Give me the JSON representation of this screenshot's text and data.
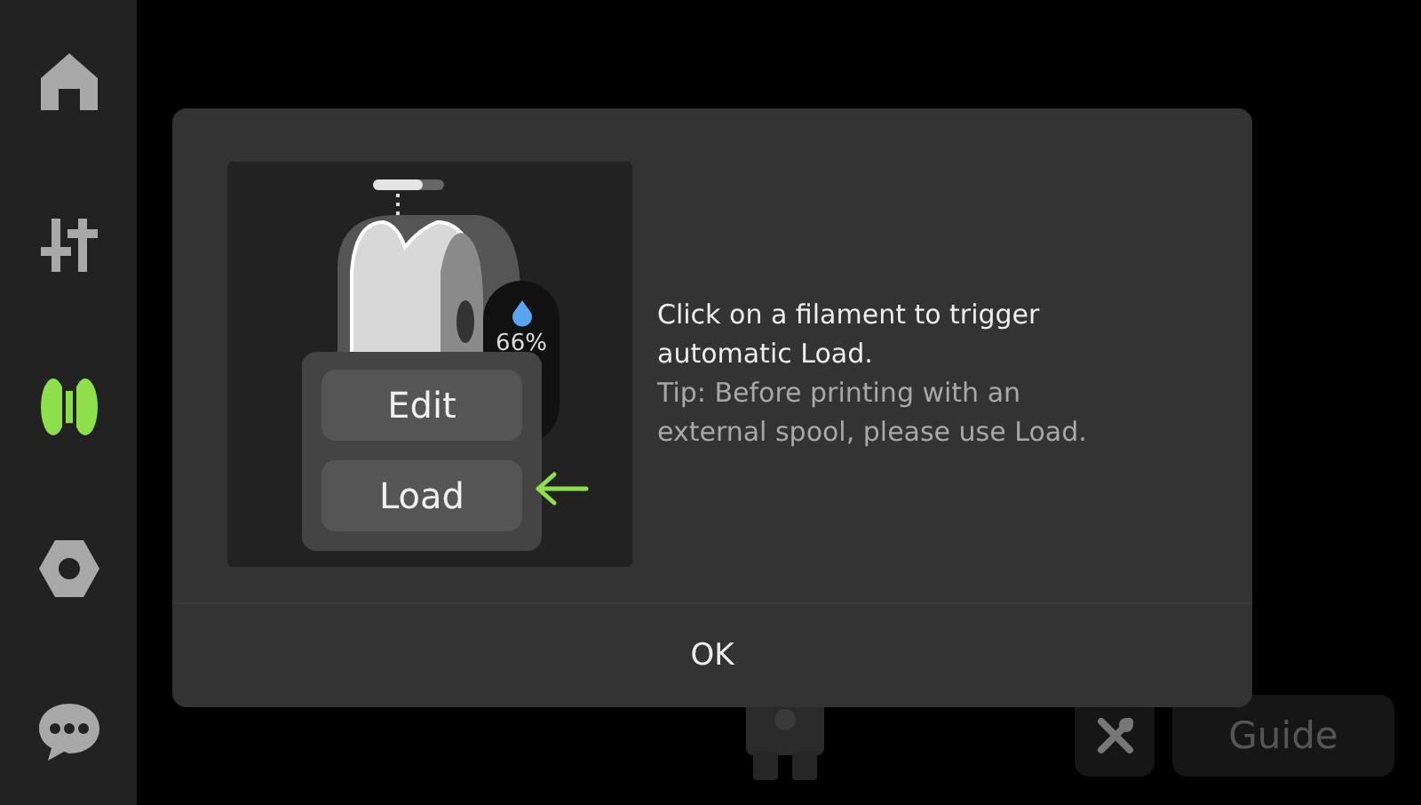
{
  "sidebar": {
    "items": [
      {
        "kind": "home",
        "selected": false
      },
      {
        "kind": "controls",
        "selected": false
      },
      {
        "kind": "filament",
        "selected": true
      },
      {
        "kind": "nut",
        "selected": false
      },
      {
        "kind": "chat",
        "selected": false
      }
    ]
  },
  "background": {
    "buttons": [
      {
        "kind": "icon"
      },
      {
        "kind": "text",
        "label": "Guide"
      }
    ]
  },
  "dialog": {
    "illustration": {
      "percent": "66%",
      "menu": [
        "Edit",
        "Load"
      ]
    },
    "message": "Click on a filament to trigger automatic Load.",
    "tip": "Tip: Before printing with an external spool, please use Load.",
    "button": "OK"
  }
}
